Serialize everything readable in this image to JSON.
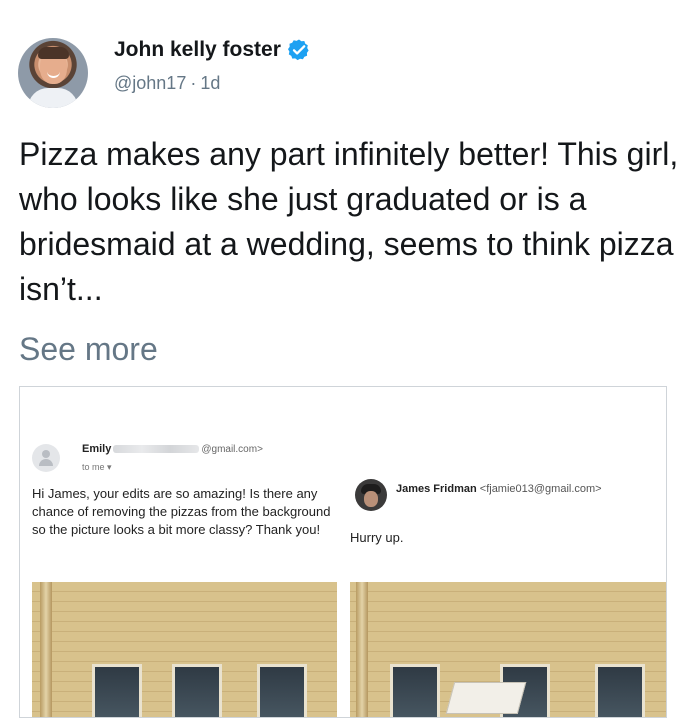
{
  "tweet": {
    "display_name": "John kelly foster",
    "handle": "@john17",
    "separator": "·",
    "time": "1d",
    "text": "Pizza makes any part infinitely better! This girl, who looks like she just graduated or is a bridesmaid at a wedding, seems to think pizza isn’t...",
    "see_more": "See more",
    "verified": true
  },
  "media": {
    "left_email": {
      "sender_name": "Emily",
      "sender_email_suffix": "@gmail.com>",
      "recipient": "to me ▾",
      "body": "Hi James, your edits are so amazing! Is there any chance of removing the pizzas from the background so the picture looks a bit more classy? Thank you!"
    },
    "right_email": {
      "sender_name": "James Fridman",
      "sender_email": "<fjamie013@gmail.com>",
      "body": "Hurry up."
    }
  },
  "colors": {
    "text": "#14171a",
    "secondary": "#657786",
    "verified": "#1da1f2"
  }
}
